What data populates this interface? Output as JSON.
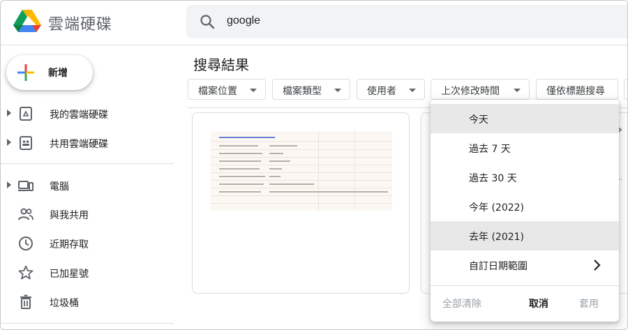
{
  "app": {
    "title": "雲端硬碟",
    "logo_icon": "google-drive-logo"
  },
  "search": {
    "value": "google",
    "icon": "search-icon"
  },
  "sidebar": {
    "new_label": "新增",
    "items": [
      {
        "label": "我的雲端硬碟",
        "icon": "my-drive-icon",
        "expandable": true
      },
      {
        "label": "共用雲端硬碟",
        "icon": "shared-drives-icon",
        "expandable": true
      },
      {
        "label": "電腦",
        "icon": "computers-icon",
        "expandable": true
      },
      {
        "label": "與我共用",
        "icon": "shared-with-me-icon",
        "expandable": false
      },
      {
        "label": "近期存取",
        "icon": "clock-icon",
        "expandable": false
      },
      {
        "label": "已加星號",
        "icon": "star-icon",
        "expandable": false
      },
      {
        "label": "垃圾桶",
        "icon": "trash-icon",
        "expandable": false
      }
    ]
  },
  "main": {
    "title": "搜尋結果",
    "filters": [
      {
        "label": "檔案位置"
      },
      {
        "label": "檔案類型"
      },
      {
        "label": "使用者"
      },
      {
        "label": "上次修改時間"
      },
      {
        "label": "僅依標題搜尋"
      }
    ]
  },
  "date_menu": {
    "options": [
      {
        "label": "今天",
        "highlighted": true
      },
      {
        "label": "過去 7 天",
        "highlighted": false
      },
      {
        "label": "過去 30 天",
        "highlighted": false
      },
      {
        "label": "今年 (2022)",
        "highlighted": false
      },
      {
        "label": "去年 (2021)",
        "highlighted": true
      },
      {
        "label": "自訂日期範圍",
        "highlighted": false,
        "has_submenu": true
      }
    ],
    "clear_label": "全部清除",
    "cancel_label": "取消",
    "apply_label": "套用"
  },
  "colors": {
    "accent": "#1a73e8",
    "highlight": "#e8e8e8",
    "disabled_text": "#9aa0a6"
  }
}
